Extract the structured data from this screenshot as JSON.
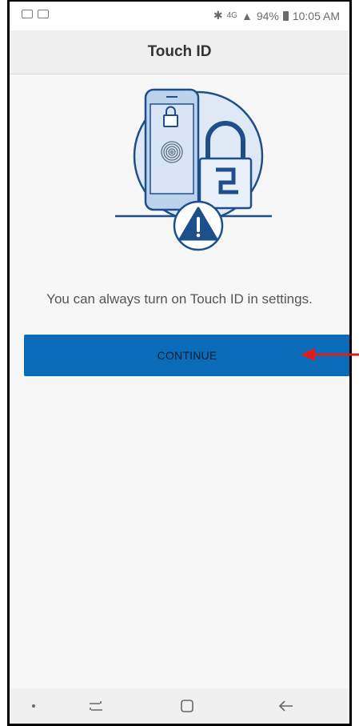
{
  "status_bar": {
    "battery": "94%",
    "time": "10:05 AM",
    "network": "4G"
  },
  "app_bar": {
    "title": "Touch ID"
  },
  "main": {
    "message": "You can always turn on Touch ID in settings.",
    "continue_label": "CONTINUE"
  },
  "colors": {
    "accent_button": "#0a6cb8",
    "annotation_arrow": "#e01b1b",
    "illustration_blue": "#1f4f8a"
  },
  "icons": {
    "illustration": "touch-id-warning-illustration",
    "annotation": "red-arrow-annotation",
    "nav": [
      "dot-icon",
      "recent-apps-icon",
      "home-icon",
      "back-icon"
    ]
  }
}
